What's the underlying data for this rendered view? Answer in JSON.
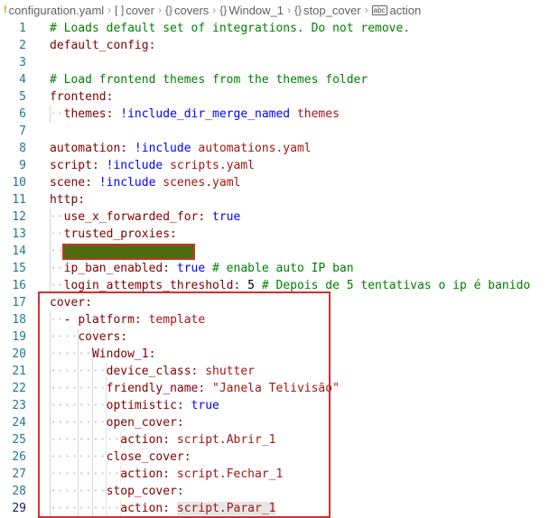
{
  "breadcrumb": {
    "file": "configuration.yaml",
    "items": [
      {
        "icon": "[ ]",
        "label": "cover"
      },
      {
        "icon": "{}",
        "label": "covers"
      },
      {
        "icon": "{}",
        "label": "Window_1"
      },
      {
        "icon": "{}",
        "label": "stop_cover"
      },
      {
        "icon": "abc",
        "label": "action"
      }
    ]
  },
  "lines": [
    {
      "n": "1",
      "t": "# Loads default set of integrations. Do not remove."
    },
    {
      "n": "2",
      "t": "default_config:"
    },
    {
      "n": "3",
      "t": ""
    },
    {
      "n": "4",
      "t": "# Load frontend themes from the themes folder"
    },
    {
      "n": "5",
      "t": "frontend:"
    },
    {
      "n": "6",
      "k": "themes:",
      "tag": "!include_dir_merge_named",
      "v": "themes"
    },
    {
      "n": "7",
      "t": ""
    },
    {
      "n": "8",
      "k": "automation:",
      "tag": "!include",
      "v": "automations.yaml"
    },
    {
      "n": "9",
      "k": "script:",
      "tag": "!include",
      "v": "scripts.yaml"
    },
    {
      "n": "10",
      "k": "scene:",
      "tag": "!include",
      "v": "scenes.yaml"
    },
    {
      "n": "11",
      "t": "http:"
    },
    {
      "n": "12",
      "k": "use_x_forwarded_for:",
      "v": "true"
    },
    {
      "n": "13",
      "k": "trusted_proxies:"
    },
    {
      "n": "14",
      "t": ""
    },
    {
      "n": "15",
      "k": "ip_ban_enabled:",
      "v": "true",
      "c": "# enable auto IP ban"
    },
    {
      "n": "16",
      "k": "login_attempts_threshold:",
      "v": "5",
      "c": "# Depois de 5 tentativas o ip é banido"
    },
    {
      "n": "17",
      "t": "cover:"
    },
    {
      "n": "18",
      "k": "platform:",
      "v": "template"
    },
    {
      "n": "19",
      "k": "covers:"
    },
    {
      "n": "20",
      "k": "Window_1:"
    },
    {
      "n": "21",
      "k": "device_class:",
      "v": "shutter"
    },
    {
      "n": "22",
      "k": "friendly_name:",
      "v": "\"Janela Telivisão\""
    },
    {
      "n": "23",
      "k": "optimistic:",
      "v": "true"
    },
    {
      "n": "24",
      "k": "open_cover:"
    },
    {
      "n": "25",
      "k": "action:",
      "v": "script.Abrir_1"
    },
    {
      "n": "26",
      "k": "close_cover:"
    },
    {
      "n": "27",
      "k": "action:",
      "v": "script.Fechar_1"
    },
    {
      "n": "28",
      "k": "stop_cover:"
    },
    {
      "n": "29",
      "k": "action:",
      "v": "script.Parar_1"
    }
  ],
  "annotations": {
    "highlight_color": "#d32f2f",
    "redaction_color": "#4f6b10"
  }
}
